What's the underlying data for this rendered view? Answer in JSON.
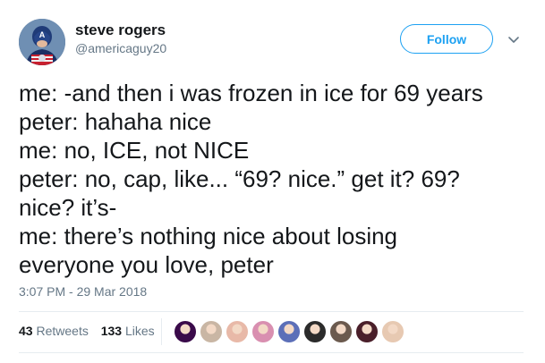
{
  "user": {
    "name": "steve rogers",
    "handle": "@americaguy20"
  },
  "follow_button": {
    "label": "Follow"
  },
  "tweet": {
    "lines": [
      "me: -and then i was frozen in ice for 69 years",
      "peter: hahaha nice",
      "me: no, ICE, not NICE",
      "peter: no, cap, like... “69? nice.” get it? 69?",
      "nice? it’s-",
      "me: there’s nothing nice about losing",
      "everyone you love, peter"
    ],
    "timestamp": "3:07 PM - 29 Mar 2018"
  },
  "stats": {
    "retweets_count": "43",
    "retweets_label": "Retweets",
    "likes_count": "133",
    "likes_label": "Likes"
  },
  "likers": [
    {
      "color": "#3a0a4a"
    },
    {
      "color": "#c9b6a4"
    },
    {
      "color": "#e8b9a8"
    },
    {
      "color": "#d98fb0"
    },
    {
      "color": "#5c6fb8"
    },
    {
      "color": "#2b2b2b"
    },
    {
      "color": "#6b5a4e"
    },
    {
      "color": "#4a1f2a"
    },
    {
      "color": "#e7c9b2"
    }
  ],
  "colors": {
    "accent": "#1da1f2",
    "text": "#14171a",
    "secondary": "#657786"
  }
}
